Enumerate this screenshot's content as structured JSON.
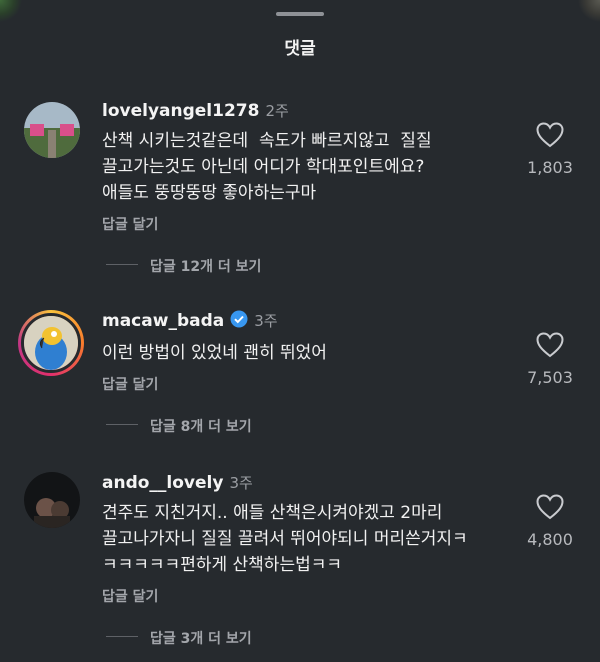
{
  "header": {
    "title": "댓글"
  },
  "comments": [
    {
      "username": "lovelyangel1278",
      "time": "2주",
      "lines": [
        "산책 시키는것같은데  속도가 빠르지않고  질질",
        "끌고가는것도 아닌데 어디가 학대포인트에요?",
        "애들도 뚱땅뚱땅 좋아하는구마"
      ],
      "reply_label": "답글 달기",
      "more_replies": "답글 12개 더 보기",
      "likes": "1,803",
      "verified": false
    },
    {
      "username": "macaw_bada",
      "time": "3주",
      "lines": [
        "이런 방법이 있었네 괜히 뛰었어"
      ],
      "reply_label": "답글 달기",
      "more_replies": "답글 8개 더 보기",
      "likes": "7,503",
      "verified": true
    },
    {
      "username": "ando__lovely",
      "time": "3주",
      "lines": [
        "견주도 지친거지.. 애들 산책은시켜야겠고 2마리",
        "끌고나가자니 질질 끌려서 뛰어야되니 머리쓴거지ㅋ",
        "ㅋㅋㅋㅋㅋ편하게 산책하는법ㅋㅋ"
      ],
      "reply_label": "답글 달기",
      "more_replies": "답글 3개 더 보기",
      "likes": "4,800",
      "verified": false
    }
  ],
  "colors": {
    "background": "#262a2e",
    "verified": "#3897f0",
    "secondary_text": "#9b9ea3"
  }
}
